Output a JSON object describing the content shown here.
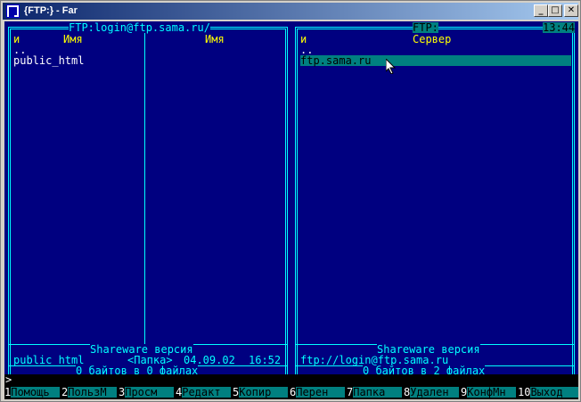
{
  "window": {
    "title": "{FTP:} - Far",
    "buttons": {
      "minimize": "_",
      "maximize": "□",
      "close": "✕"
    }
  },
  "left_panel": {
    "title": "FTP:login@ftp.sama.ru/",
    "col1_header": "и",
    "col2_header": "Имя",
    "col3_header": "Имя",
    "items": [
      "..",
      "public_html"
    ],
    "footer_title": "Shareware версия",
    "status_name": "public_html",
    "status_type": "<Папка>",
    "status_date": "04.09.02",
    "status_time": "16:52",
    "summary": "0 байтов в 0 файлах"
  },
  "right_panel": {
    "title": "FTP:",
    "clock": "13:44",
    "col1_header": "и",
    "col2_header": "Сервер",
    "items": [
      "..",
      "ftp.sama.ru"
    ],
    "footer_title": "Shareware версия",
    "status_path": "ftp://login@ftp.sama.ru",
    "summary": "0 байтов в 2 файлах"
  },
  "command_line": {
    "prompt": ">"
  },
  "keybar": [
    {
      "num": "1",
      "label": "Помощь"
    },
    {
      "num": "2",
      "label": "ПользМ"
    },
    {
      "num": "3",
      "label": "Просм"
    },
    {
      "num": "4",
      "label": "Редакт"
    },
    {
      "num": "5",
      "label": "Копир"
    },
    {
      "num": "6",
      "label": "Перен"
    },
    {
      "num": "7",
      "label": "Папка"
    },
    {
      "num": "8",
      "label": "Удален"
    },
    {
      "num": "9",
      "label": "КонфМн"
    },
    {
      "num": "10",
      "label": "Выход"
    }
  ]
}
